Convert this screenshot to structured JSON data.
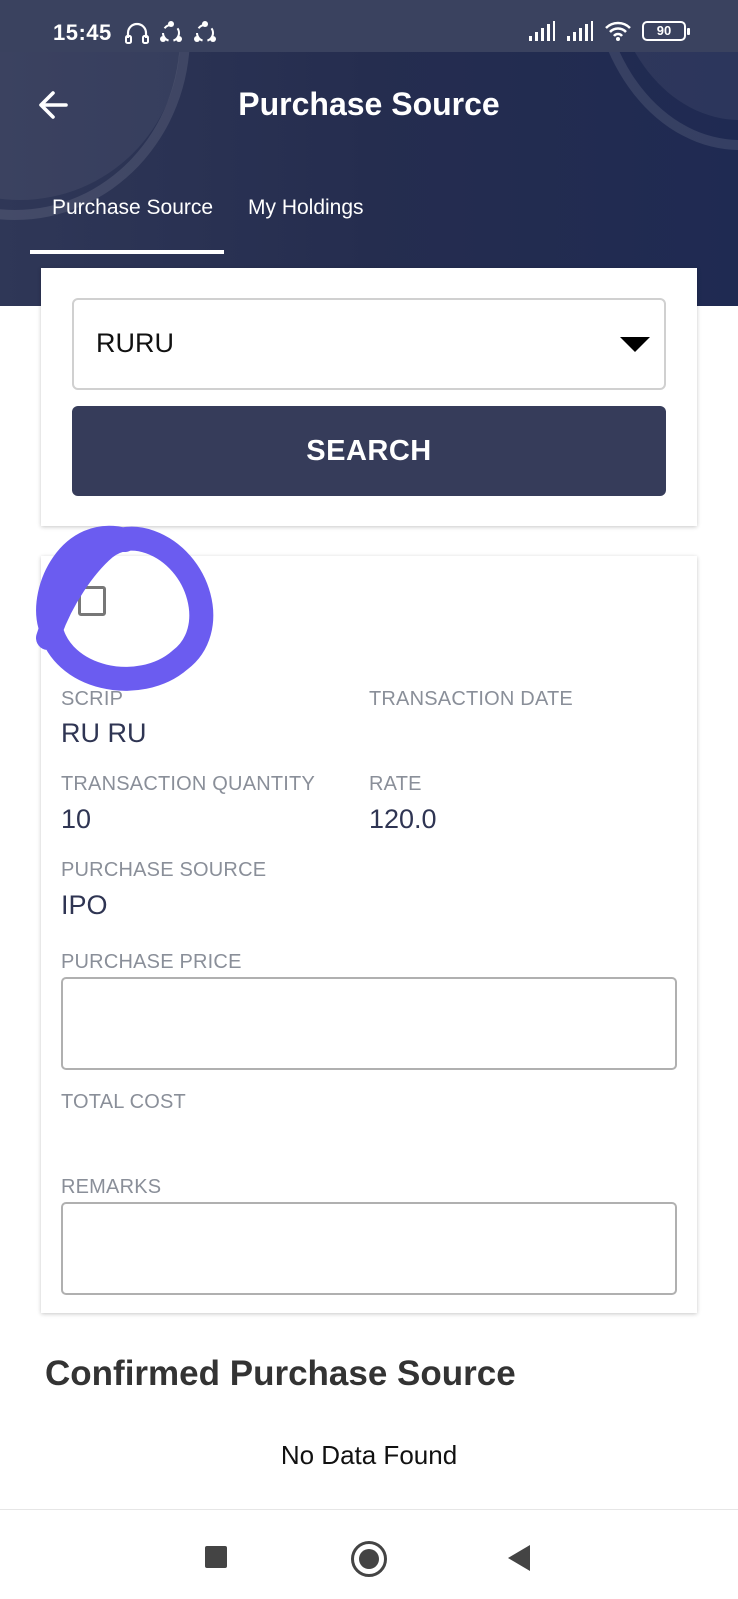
{
  "status_bar": {
    "time": "15:45",
    "battery": "90",
    "left_icons": [
      "headphones-icon",
      "share-icon",
      "share-icon"
    ],
    "right_icons": [
      "signal-icon",
      "signal-icon",
      "wifi-icon"
    ]
  },
  "header": {
    "title": "Purchase Source",
    "back_icon": "arrow-left-icon"
  },
  "tabs": [
    {
      "label": "Purchase Source",
      "active": true
    },
    {
      "label": "My Holdings",
      "active": false
    }
  ],
  "search_card": {
    "selected_scrip": "RURU",
    "search_label": "SEARCH"
  },
  "transaction_card": {
    "checked": false,
    "scrip_label": "SCRIP",
    "scrip_value": "RU RU",
    "transaction_date_label": "TRANSACTION DATE",
    "transaction_date_value": "",
    "quantity_label": "TRANSACTION QUANTITY",
    "quantity_value": "10",
    "rate_label": "RATE",
    "rate_value": "120.0",
    "purchase_source_label": "PURCHASE SOURCE",
    "purchase_source_value": "IPO",
    "purchase_price_label": "PURCHASE PRICE",
    "purchase_price_value": "",
    "total_cost_label": "TOTAL COST",
    "total_cost_value": "",
    "remarks_label": "REMARKS",
    "remarks_value": ""
  },
  "confirmed": {
    "title": "Confirmed Purchase Source",
    "empty_text": "No Data Found"
  },
  "colors": {
    "header": "#252d4f",
    "button": "#363c5a",
    "annotation": "#6b5cf0"
  }
}
